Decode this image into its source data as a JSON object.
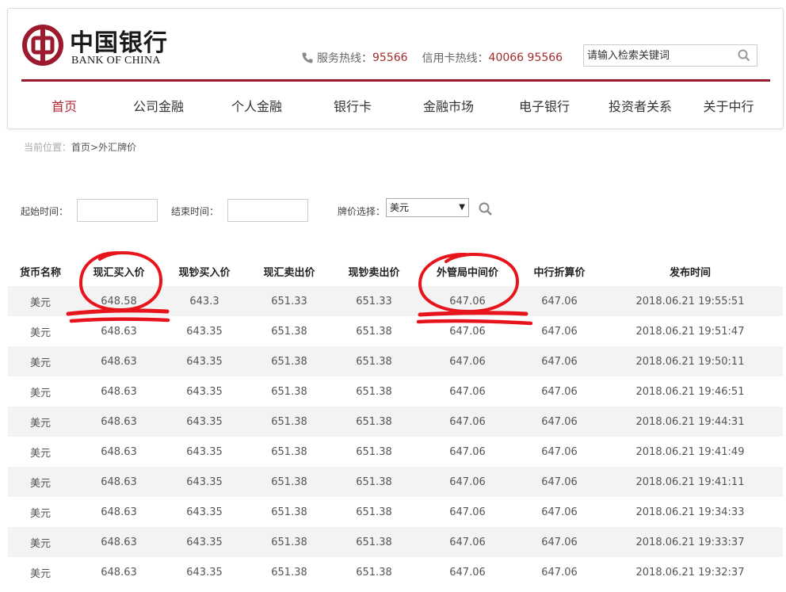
{
  "brand": {
    "name_cn": "中国银行",
    "name_en": "BANK OF CHINA",
    "color": "#9c1a2e"
  },
  "hotlines": {
    "service_label": "服务热线：",
    "service_number": "95566",
    "card_label": "信用卡热线：",
    "card_number": "40066 95566",
    "icon": "phone-icon"
  },
  "search": {
    "placeholder": "请输入检索关键词",
    "icon": "search-icon"
  },
  "nav": [
    {
      "label": "首页",
      "active": true
    },
    {
      "label": "公司金融",
      "active": false
    },
    {
      "label": "个人金融",
      "active": false
    },
    {
      "label": "银行卡",
      "active": false
    },
    {
      "label": "金融市场",
      "active": false
    },
    {
      "label": "电子银行",
      "active": false
    },
    {
      "label": "投资者关系",
      "active": false
    },
    {
      "label": "关于中行",
      "active": false
    }
  ],
  "breadcrumb": {
    "prefix": "当前位置：",
    "path": "首页>外汇牌价"
  },
  "filter": {
    "start_label": "起始时间：",
    "end_label": "结束时间：",
    "select_label": "牌价选择：",
    "selected_currency": "美元"
  },
  "table": {
    "headers": [
      "货币名称",
      "现汇买入价",
      "现钞买入价",
      "现汇卖出价",
      "现钞卖出价",
      "外管局中间价",
      "中行折算价",
      "发布时间"
    ],
    "rows": [
      [
        "美元",
        "648.58",
        "643.3",
        "651.33",
        "651.33",
        "647.06",
        "647.06",
        "2018.06.21 19:55:51"
      ],
      [
        "美元",
        "648.63",
        "643.35",
        "651.38",
        "651.38",
        "647.06",
        "647.06",
        "2018.06.21 19:51:47"
      ],
      [
        "美元",
        "648.63",
        "643.35",
        "651.38",
        "651.38",
        "647.06",
        "647.06",
        "2018.06.21 19:50:11"
      ],
      [
        "美元",
        "648.63",
        "643.35",
        "651.38",
        "651.38",
        "647.06",
        "647.06",
        "2018.06.21 19:46:51"
      ],
      [
        "美元",
        "648.63",
        "643.35",
        "651.38",
        "651.38",
        "647.06",
        "647.06",
        "2018.06.21 19:44:31"
      ],
      [
        "美元",
        "648.63",
        "643.35",
        "651.38",
        "651.38",
        "647.06",
        "647.06",
        "2018.06.21 19:41:49"
      ],
      [
        "美元",
        "648.63",
        "643.35",
        "651.38",
        "651.38",
        "647.06",
        "647.06",
        "2018.06.21 19:41:11"
      ],
      [
        "美元",
        "648.63",
        "643.35",
        "651.38",
        "651.38",
        "647.06",
        "647.06",
        "2018.06.21 19:34:33"
      ],
      [
        "美元",
        "648.63",
        "643.35",
        "651.38",
        "651.38",
        "647.06",
        "647.06",
        "2018.06.21 19:33:37"
      ],
      [
        "美元",
        "648.63",
        "643.35",
        "651.38",
        "651.38",
        "647.06",
        "647.06",
        "2018.06.21 19:32:37"
      ]
    ]
  },
  "annotation_color": "#e8141c"
}
